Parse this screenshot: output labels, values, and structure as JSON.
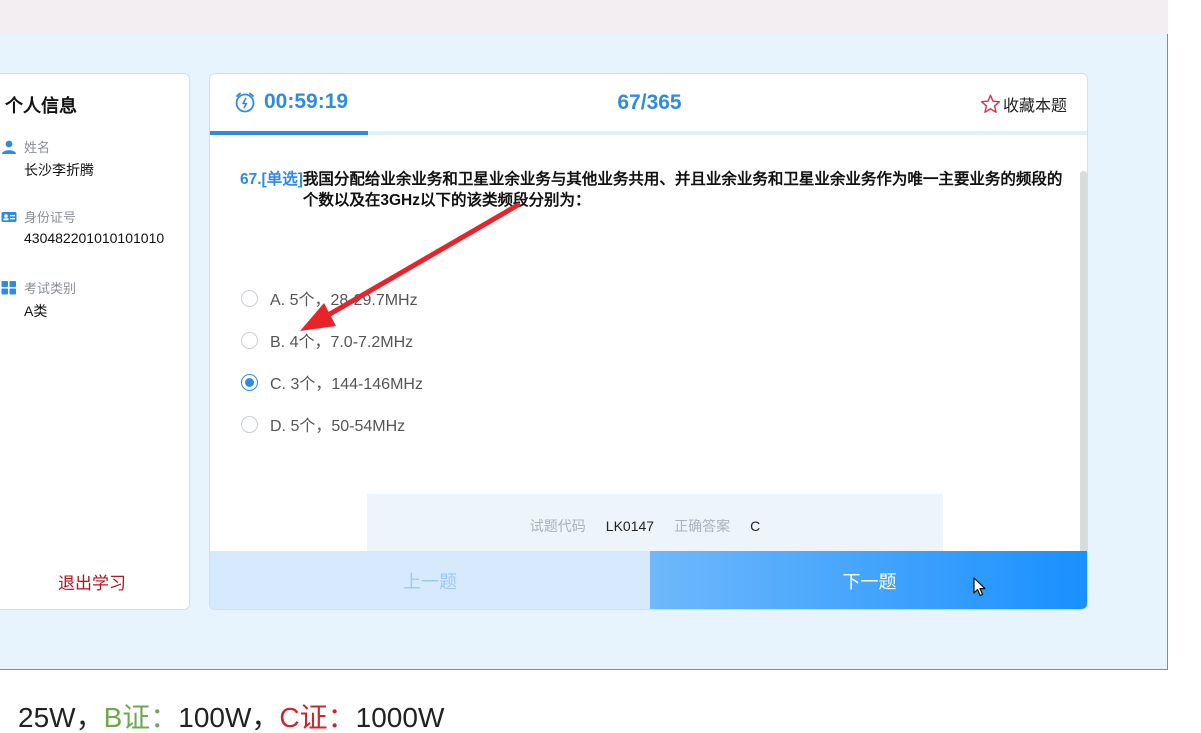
{
  "sidebar": {
    "title": "个人信息",
    "name_label": "姓名",
    "name_value": "长沙李折腾",
    "id_label": "身份证号",
    "id_value": "430482201010101010",
    "type_label": "考试类别",
    "type_value": "A类",
    "logout_label": "退出学习"
  },
  "header": {
    "timer": "00:59:19",
    "progress": "67/365",
    "progress_fraction": 0.18,
    "favorite_label": "收藏本题"
  },
  "question": {
    "prefix": "67.[单选]",
    "text": "我国分配给业余业务和卫星业余业务与其他业务共用、并且业余业务和卫星业余业务作为唯一主要业务的频段的个数以及在3GHz以下的该类频段分别为：",
    "options": [
      {
        "label": "A. 5个，28-29.7MHz",
        "checked": false
      },
      {
        "label": "B. 4个，7.0-7.2MHz",
        "checked": false
      },
      {
        "label": "C. 3个，144-146MHz",
        "checked": true
      },
      {
        "label": "D. 5个，50-54MHz",
        "checked": false
      }
    ]
  },
  "answer": {
    "code_label": "试题代码",
    "code_value": "LK0147",
    "correct_label": "正确答案",
    "correct_value": "C"
  },
  "nav": {
    "prev_label": "上一题",
    "next_label": "下一题"
  },
  "caption": {
    "part1": "25W，",
    "b_label": "B证：",
    "part2": "100W，",
    "c_label": "C证：",
    "part3": "1000W"
  },
  "colors": {
    "accent": "#2f8be0",
    "annotation_arrow": "#e8232a"
  }
}
